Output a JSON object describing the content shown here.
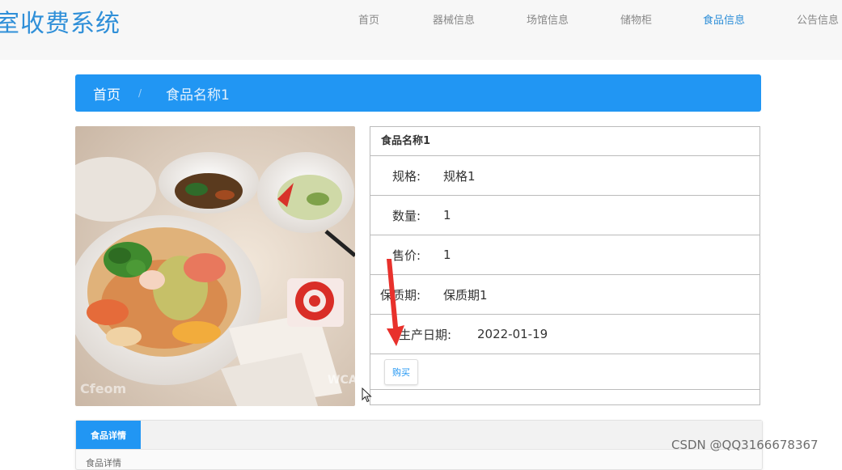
{
  "header": {
    "brand": "室收费系统",
    "nav": [
      {
        "label": "首页",
        "active": false
      },
      {
        "label": "器械信息",
        "active": false
      },
      {
        "label": "场馆信息",
        "active": false
      },
      {
        "label": "储物柜",
        "active": false
      },
      {
        "label": "食品信息",
        "active": true
      },
      {
        "label": "公告信息",
        "active": false
      }
    ]
  },
  "breadcrumb": {
    "home": "首页",
    "separator": "/",
    "current": "食品名称1"
  },
  "product": {
    "image_alt": "food-photo",
    "image_watermark_left": "Cfeom",
    "image_watermark_right": "WCA",
    "title": "食品名称1",
    "fields": [
      {
        "label": "规格:",
        "value": "规格1"
      },
      {
        "label": "数量:",
        "value": "1"
      },
      {
        "label": "售价:",
        "value": "1"
      },
      {
        "label": "保质期:",
        "value": "保质期1"
      },
      {
        "label": "生产日期:",
        "value": "2022-01-19"
      }
    ],
    "buy_label": "购买"
  },
  "tabs": {
    "active_label": "食品详情",
    "content_snippet": "食品详情"
  },
  "watermark": "CSDN @QQ3166678367",
  "colors": {
    "accent": "#2196f3",
    "brand": "#2f8fd8",
    "annotation": "#e8312c"
  }
}
